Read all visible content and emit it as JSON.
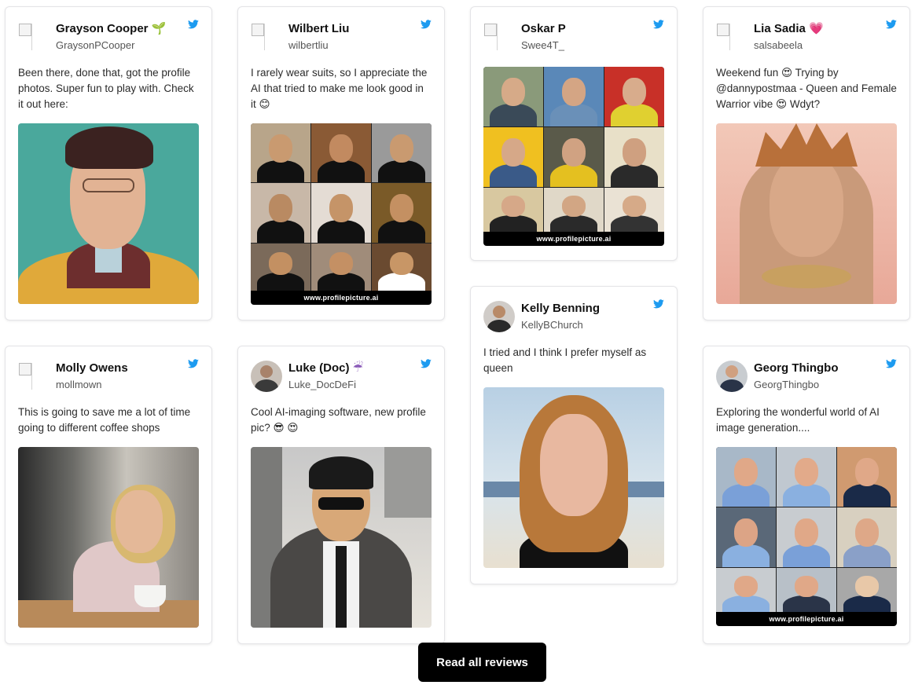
{
  "reviews": [
    {
      "name": "Grayson Cooper",
      "emoji": "🌱",
      "handle": "GraysonPCooper",
      "text": "Been there, done that, got the profile photos. Super fun to play with. Check it out here:"
    },
    {
      "name": "Wilbert Liu",
      "emoji": "",
      "handle": "wilbertliu",
      "text": "I rarely wear suits, so I appreciate the AI that tried to make me look good in it 😊",
      "watermark": "www.profilepicture.ai"
    },
    {
      "name": "Oskar P",
      "emoji": "",
      "handle": "Swee4T_",
      "text": "",
      "watermark": "www.profilepicture.ai"
    },
    {
      "name": "Lia Sadia",
      "emoji": "💗",
      "handle": "salsabeela",
      "text": "Weekend fun 😍 Trying by @dannypostmaa - Queen and Female Warrior vibe 😍 Wdyt?"
    },
    {
      "name": "Molly Owens",
      "emoji": "",
      "handle": "mollmown",
      "text": "This is going to save me a lot of time going to different coffee shops"
    },
    {
      "name": "Luke (Doc)",
      "emoji": "☔",
      "handle": "Luke_DocDeFi",
      "text": "Cool AI-imaging software, new profile pic? 😎 😍"
    },
    {
      "name": "Kelly Benning",
      "emoji": "",
      "handle": "KellyBChurch",
      "text": "I tried and I think I prefer myself as queen"
    },
    {
      "name": "Georg Thingbo",
      "emoji": "",
      "handle": "GeorgThingbo",
      "text": "Exploring the wonderful world of AI image generation....",
      "watermark": "www.profilepicture.ai"
    }
  ],
  "cta": {
    "label": "Read all reviews"
  },
  "colors": {
    "twitter": "#1d9bf0",
    "cta_bg": "#000000"
  }
}
